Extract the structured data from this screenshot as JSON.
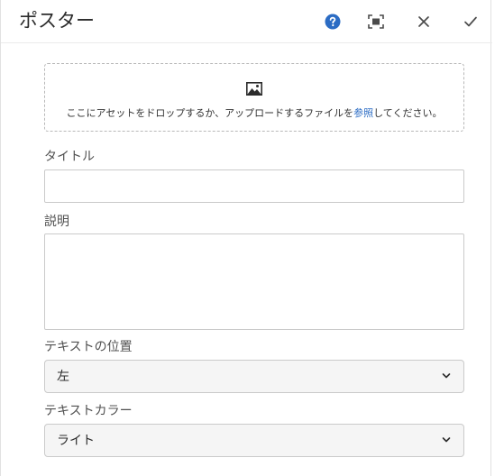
{
  "dialog": {
    "title": "ポスター",
    "actions": {
      "help_icon": "help-icon",
      "fullscreen_icon": "fullscreen-icon",
      "close_icon": "close-icon",
      "done_icon": "checkmark-icon"
    }
  },
  "dropzone": {
    "icon": "image-icon",
    "text_before": "ここにアセットをドロップするか、アップロードするファイルを",
    "link_text": "参照",
    "text_after": "してください。"
  },
  "form": {
    "title_label": "タイトル",
    "title_value": "",
    "description_label": "説明",
    "description_value": "",
    "text_position_label": "テキストの位置",
    "text_position_value": "左",
    "text_color_label": "テキストカラー",
    "text_color_value": "ライト"
  },
  "colors": {
    "help_blue": "#2b6cc4",
    "link_blue": "#2b6cc4"
  }
}
